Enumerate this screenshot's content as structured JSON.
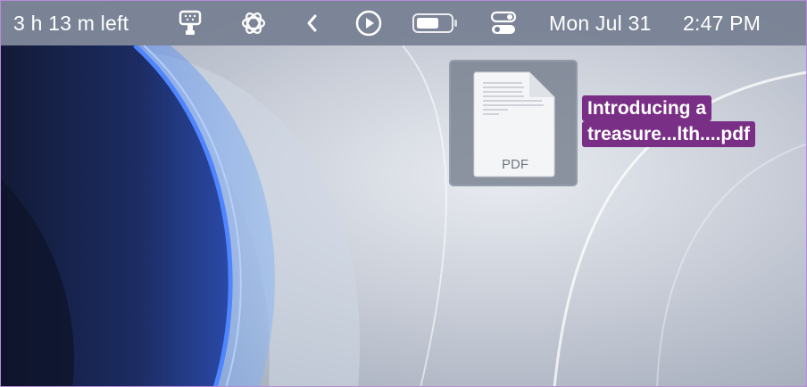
{
  "menubar": {
    "battery_time": "3 h 13 m left",
    "date": "Mon Jul 31",
    "time": "2:47 PM",
    "icons": [
      "shower-icon",
      "chatgpt-icon",
      "chevron-left-icon",
      "play-icon",
      "battery-icon",
      "control-center-icon"
    ]
  },
  "desktop": {
    "file": {
      "type_label": "PDF",
      "name_line1": "Introducing a",
      "name_line2": "treasure...lth....pdf"
    }
  },
  "colors": {
    "menubar": "#768092",
    "selection": "#7a2f86",
    "accent_border": "#b68cd6"
  }
}
